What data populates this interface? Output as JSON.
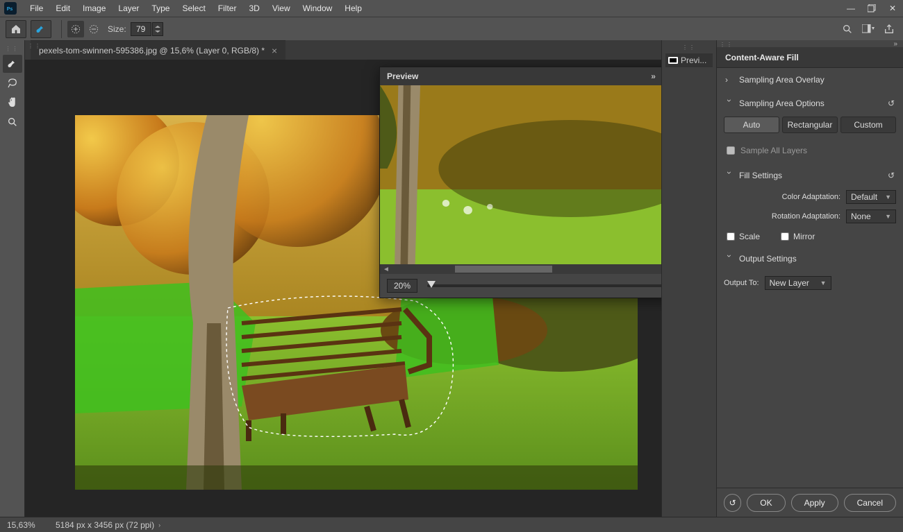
{
  "menu": [
    "File",
    "Edit",
    "Image",
    "Layer",
    "Type",
    "Select",
    "Filter",
    "3D",
    "View",
    "Window",
    "Help"
  ],
  "options": {
    "size_label": "Size:",
    "size_value": "79"
  },
  "document": {
    "tab_title": "pexels-tom-swinnen-595386.jpg @ 15,6% (Layer 0, RGB/8) *"
  },
  "preview": {
    "title": "Preview",
    "zoom_value": "20%"
  },
  "mid_tab": "Previ...",
  "caf": {
    "title": "Content-Aware Fill",
    "section_overlay": "Sampling Area Overlay",
    "section_opts": "Sampling Area Options",
    "auto": "Auto",
    "rect": "Rectangular",
    "custom": "Custom",
    "sample_all": "Sample All Layers",
    "fill_settings": "Fill Settings",
    "color_adapt": "Color Adaptation:",
    "color_adapt_val": "Default",
    "rot_adapt": "Rotation Adaptation:",
    "rot_adapt_val": "None",
    "scale": "Scale",
    "mirror": "Mirror",
    "output_settings": "Output Settings",
    "output_to": "Output To:",
    "output_val": "New Layer",
    "ok": "OK",
    "apply": "Apply",
    "cancel": "Cancel"
  },
  "status": {
    "zoom": "15,63%",
    "dims": "5184 px x 3456 px (72 ppi)"
  }
}
